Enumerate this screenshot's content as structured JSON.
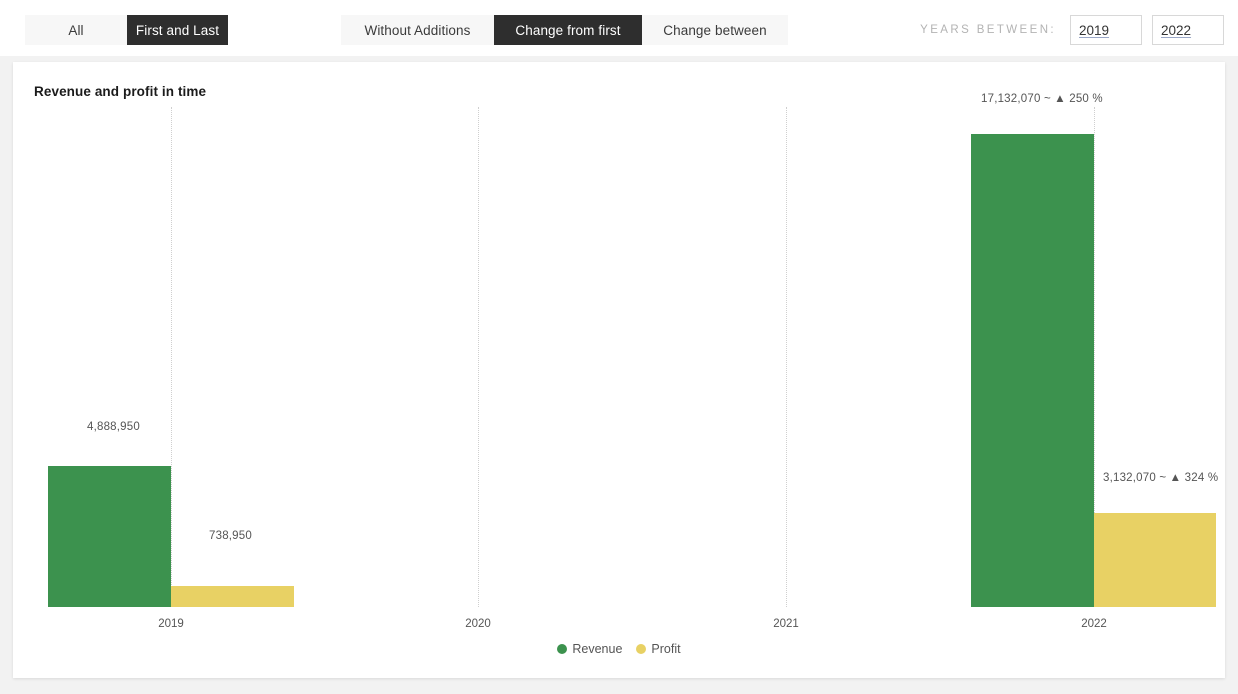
{
  "toolbar": {
    "scope_group": [
      {
        "label": "All",
        "active": false
      },
      {
        "label": "First and Last",
        "active": true
      }
    ],
    "mode_group": [
      {
        "label": "Without Additions",
        "active": false
      },
      {
        "label": "Change from first",
        "active": true
      },
      {
        "label": "Change between",
        "active": false
      }
    ],
    "years_label": "YEARS BETWEEN:",
    "year_from": "2019",
    "year_to": "2022",
    "year_from_placeholder": "2019",
    "year_to_placeholder": "2022"
  },
  "card": {
    "title": "Revenue and profit in time"
  },
  "colors": {
    "revenue": "#3c924e",
    "profit": "#e8d164",
    "active_toggle_bg": "#2e2e2e",
    "inactive_toggle_bg": "#f7f7f7",
    "page_bg": "#f2f2f2",
    "card_bg": "#ffffff"
  },
  "chart_data": {
    "type": "bar",
    "title": "Revenue and profit in time",
    "xlabel": "",
    "ylabel": "",
    "grid": "vertical-dotted",
    "legend_position": "bottom-center",
    "categories": [
      "2019",
      "2020",
      "2021",
      "2022"
    ],
    "ylim": [
      0,
      18500000
    ],
    "series": [
      {
        "name": "Revenue",
        "color": "#3c924e",
        "values": [
          4888950,
          null,
          null,
          17132070
        ],
        "labels": [
          "4,888,950",
          "",
          "",
          "17,132,070 ~ ▲ 250 %"
        ]
      },
      {
        "name": "Profit",
        "color": "#e8d164",
        "values": [
          738950,
          null,
          null,
          3132070
        ],
        "labels": [
          "738,950",
          "",
          "",
          "3,132,070 ~ ▲ 324 %"
        ]
      }
    ],
    "annotations": [
      {
        "series": "Revenue",
        "category": "2019",
        "text": "4,888,950"
      },
      {
        "series": "Profit",
        "category": "2019",
        "text": "738,950"
      },
      {
        "series": "Revenue",
        "category": "2022",
        "text": "17,132,070 ~ ▲ 250 %",
        "change_pct": 250,
        "direction": "up"
      },
      {
        "series": "Profit",
        "category": "2022",
        "text": "3,132,070 ~ ▲ 324 %",
        "change_pct": 324,
        "direction": "up"
      }
    ],
    "legend": [
      {
        "label": "Revenue",
        "color": "#3c924e"
      },
      {
        "label": "Profit",
        "color": "#e8d164"
      }
    ]
  }
}
